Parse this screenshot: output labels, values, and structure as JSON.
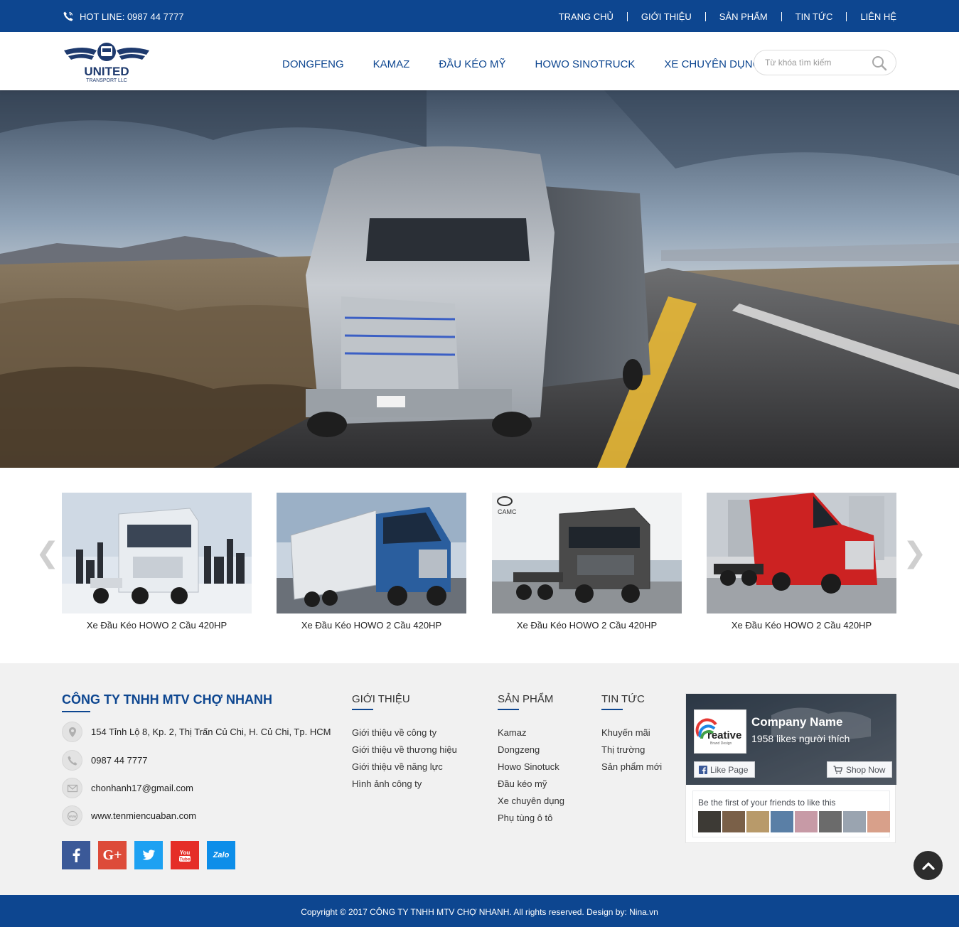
{
  "topbar": {
    "hotline": "HOT LINE: 0987 44 7777",
    "nav": [
      "TRANG CHỦ",
      "GIỚI THIỆU",
      "SẢN PHẨM",
      "TIN TỨC",
      "LIÊN HỆ"
    ]
  },
  "header": {
    "logo_text": "UNITED",
    "logo_subtext": "TRANSPORT LLC",
    "nav": [
      "DONGFENG",
      "KAMAZ",
      "ĐẦU KÉO MỸ",
      "HOWO SINOTRUCK",
      "XE CHUYÊN DỤNG"
    ],
    "search_placeholder": "Từ khóa tìm kiếm"
  },
  "slider": {
    "prev_arrow": "❮",
    "next_arrow": "❯",
    "products": [
      {
        "name": "Xe Đầu Kéo HOWO 2 Cầu 420HP",
        "truck_color": "#e8ecf0"
      },
      {
        "name": "Xe Đầu Kéo HOWO 2 Cầu 420HP",
        "truck_color": "#2a5e9e"
      },
      {
        "name": "Xe Đầu Kéo HOWO 2 Cầu 420HP",
        "truck_color": "#4a4a4a"
      },
      {
        "name": "Xe Đầu Kéo HOWO 2 Cầu 420HP",
        "truck_color": "#cc2222"
      }
    ],
    "product3_brand": "CAMC"
  },
  "footer": {
    "company_title": "CÔNG TY TNHH MTV CHỢ NHANH",
    "contact": {
      "address": "154 Tỉnh Lộ 8, Kp. 2, Thị Trấn Củ Chi, H. Củ Chi, Tp. HCM",
      "phone": "0987 44 7777",
      "email": "chonhanh17@gmail.com",
      "website": "www.tenmiencuaban.com"
    },
    "social": [
      {
        "icon": "facebook-icon",
        "label": "f",
        "color": "#3b5998"
      },
      {
        "icon": "google-plus-icon",
        "label": "G+",
        "color": "#dd4b39"
      },
      {
        "icon": "twitter-icon",
        "label": "",
        "color": "#1da1f2"
      },
      {
        "icon": "youtube-icon",
        "label": "You",
        "color": "#e52d27"
      },
      {
        "icon": "zalo-icon",
        "label": "Zalo",
        "color": "#0d8ee9"
      }
    ],
    "col_gioithieu": {
      "title": "GIỚI THIỆU",
      "links": [
        "Giới thiệu về công ty",
        "Giới thiệu về thương hiệu",
        "Giới thiệu về năng lực",
        "Hình ảnh công ty"
      ]
    },
    "col_sanpham": {
      "title": "SẢN PHẨM",
      "links": [
        "Kamaz",
        "Dongzeng",
        "Howo Sinotuck",
        "Đầu kéo mỹ",
        "Xe chuyên dụng",
        "Phụ tùng ô tô"
      ]
    },
    "col_tintuc": {
      "title": "TIN TỨC",
      "links": [
        "Khuyến mãi",
        "Thị trường",
        "Sản phẩm mới"
      ]
    },
    "fb": {
      "page_name": "Company Name",
      "likes": "1958 likes người thích",
      "logo_text": "reative",
      "logo_sub": "Brand Design",
      "like_button": "Like Page",
      "shop_button": "Shop Now",
      "friends_text": "Be the first of your friends to like this"
    }
  },
  "copyright": "Copyright © 2017 CÔNG TY TNHH MTV CHỢ NHANH.  All rights reserved. Design by: Nina.vn"
}
